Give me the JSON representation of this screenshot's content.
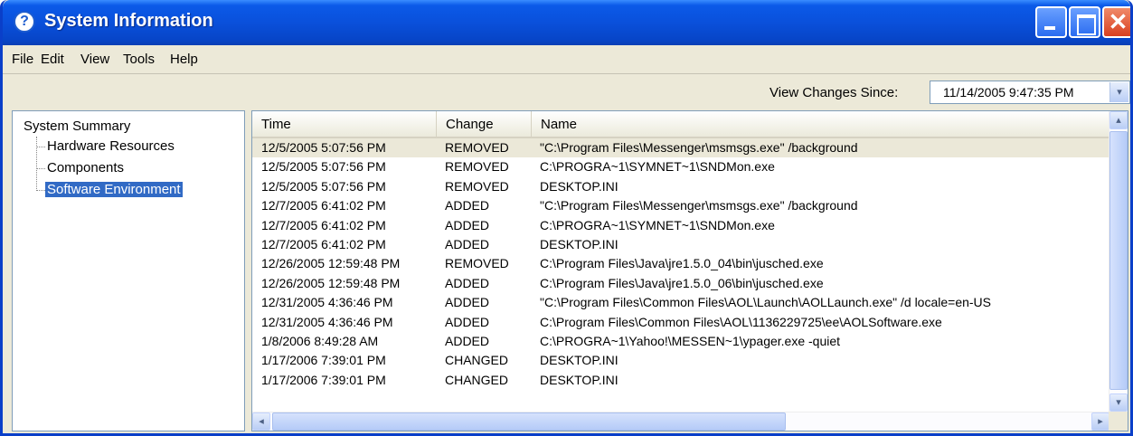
{
  "window": {
    "title": "System Information",
    "title_icon": "?"
  },
  "titlebar": {
    "close_glyph": "✕"
  },
  "menu": [
    "File",
    "Edit",
    "View",
    "Tools",
    "Help"
  ],
  "toolbar": {
    "label": "View Changes Since:",
    "selected": "11/14/2005 9:47:35 PM",
    "arrow": "▾"
  },
  "tree": {
    "root": "System Summary",
    "children": [
      "Hardware Resources",
      "Components",
      "Software Environment"
    ],
    "selected_index": 2
  },
  "list": {
    "columns": [
      "Time",
      "Change",
      "Name"
    ],
    "rows": [
      [
        "12/5/2005 5:07:56 PM",
        "REMOVED",
        "\"C:\\Program Files\\Messenger\\msmsgs.exe\" /background"
      ],
      [
        "12/5/2005 5:07:56 PM",
        "REMOVED",
        "C:\\PROGRA~1\\SYMNET~1\\SNDMon.exe"
      ],
      [
        "12/5/2005 5:07:56 PM",
        "REMOVED",
        "DESKTOP.INI"
      ],
      [
        "12/7/2005 6:41:02 PM",
        "ADDED",
        "\"C:\\Program Files\\Messenger\\msmsgs.exe\" /background"
      ],
      [
        "12/7/2005 6:41:02 PM",
        "ADDED",
        "C:\\PROGRA~1\\SYMNET~1\\SNDMon.exe"
      ],
      [
        "12/7/2005 6:41:02 PM",
        "ADDED",
        "DESKTOP.INI"
      ],
      [
        "12/26/2005 12:59:48 PM",
        "REMOVED",
        "C:\\Program Files\\Java\\jre1.5.0_04\\bin\\jusched.exe"
      ],
      [
        "12/26/2005 12:59:48 PM",
        "ADDED",
        "C:\\Program Files\\Java\\jre1.5.0_06\\bin\\jusched.exe"
      ],
      [
        "12/31/2005 4:36:46 PM",
        "ADDED",
        "\"C:\\Program Files\\Common Files\\AOL\\Launch\\AOLLaunch.exe\" /d locale=en-US"
      ],
      [
        "12/31/2005 4:36:46 PM",
        "ADDED",
        "C:\\Program Files\\Common Files\\AOL\\1136229725\\ee\\AOLSoftware.exe"
      ],
      [
        "1/8/2006 8:49:28 AM",
        "ADDED",
        "C:\\PROGRA~1\\Yahoo!\\MESSEN~1\\ypager.exe -quiet"
      ],
      [
        "1/17/2006 7:39:01 PM",
        "CHANGED",
        "DESKTOP.INI"
      ],
      [
        "1/17/2006 7:39:01 PM",
        "CHANGED",
        "DESKTOP.INI"
      ]
    ]
  },
  "scrollbar": {
    "up": "▴",
    "down": "▾",
    "left": "◂",
    "right": "▸"
  }
}
